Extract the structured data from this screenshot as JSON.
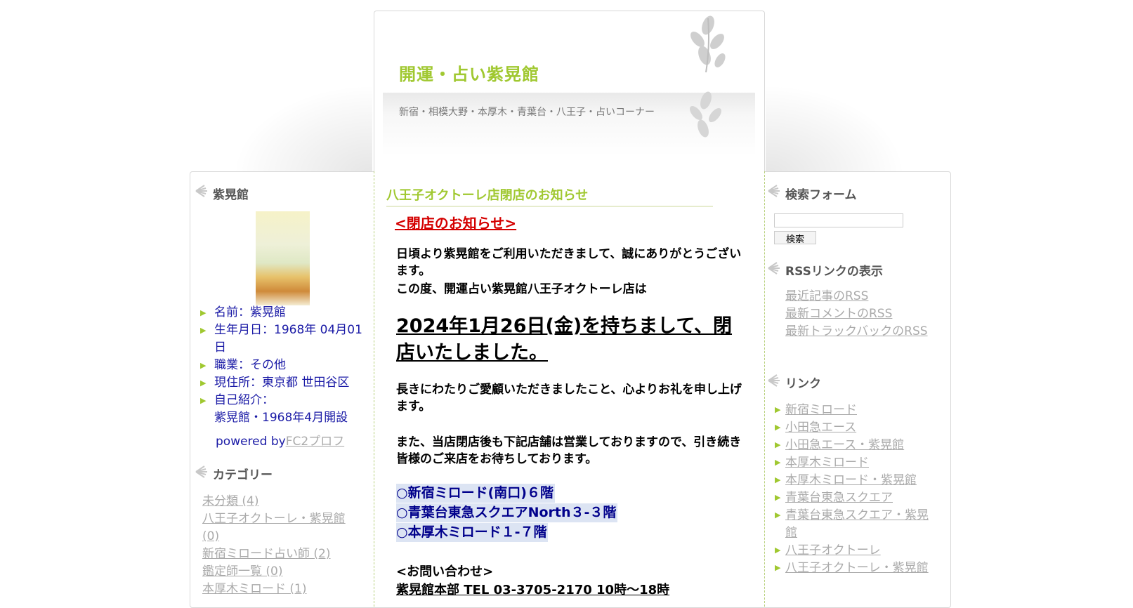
{
  "header": {
    "site_title": "開運・占い紫晃館",
    "site_description": "新宿・相模大野・本厚木・青葉台・八王子・占いコーナー"
  },
  "left_sidebar": {
    "profile_title": "紫晃館",
    "profile_items": [
      "名前：紫晃館",
      "生年月日：1968年 04月01日",
      "職業：その他",
      "現住所：東京都 世田谷区",
      "自己紹介：",
      "紫晃館・1968年4月開設"
    ],
    "powered_by": "powered by",
    "powered_link": "FC2プロフ",
    "category_title": "カテゴリー",
    "categories": [
      "未分類 (4)",
      "八王子オクトーレ・紫晃館 (0)",
      "新宿ミロード占い師 (2)",
      "鑑定師一覧 (0)",
      "本厚木ミロード (1)"
    ]
  },
  "entry": {
    "title": "八王子オクトーレ店閉店のお知らせ",
    "notice_heading": "<閉店のお知らせ>",
    "paragraph1": "日頃より紫晃館をご利用いただきまして、誠にありがとうございます。",
    "paragraph1b": "この度、開運占い紫晃館八王子オクトーレ店は",
    "big_announcement": "2024年1月26日(金)を持ちまして、閉店いたしました。",
    "paragraph2": "長きにわたりご愛顧いただきましたこと、心よりお礼を申し上げます。",
    "paragraph3": "また、当店閉店後も下記店舗は営業しておりますので、引き続き皆様のご来店をお待ちしております。",
    "stores": [
      "○新宿ミロード(南口)６階",
      "○青葉台東急スクエアNorth３-３階",
      "○本厚木ミロード１-７階"
    ],
    "contact_heading": "<お問い合わせ>",
    "contact_line": "紫晃館本部 TEL 03-3705-2170 10時～18時"
  },
  "right_sidebar": {
    "search_title": "検索フォーム",
    "search_button": "検索",
    "search_value": "",
    "rss_title": "RSSリンクの表示",
    "rss_links": [
      "最近記事のRSS",
      "最新コメントのRSS",
      "最新トラックバックのRSS"
    ],
    "links_title": "リンク",
    "links": [
      "新宿ミロード",
      "小田急エース",
      "小田急エース・紫晃館",
      "本厚木ミロード",
      "本厚木ミロード・紫晃館",
      "青葉台東急スクエア",
      "青葉台東急スクエア・紫晃館",
      "八王子オクトーレ",
      "八王子オクトーレ・紫晃館"
    ]
  },
  "colors": {
    "accent_green": "#a0c830",
    "notice_red": "#d40000",
    "profile_blue": "#1a1aa6",
    "store_navy": "#00008b",
    "link_gray": "#aaaaaa"
  },
  "icons": [
    "leaf-decoration-icon",
    "bullet-arrow-icon",
    "feather-heading-icon"
  ]
}
